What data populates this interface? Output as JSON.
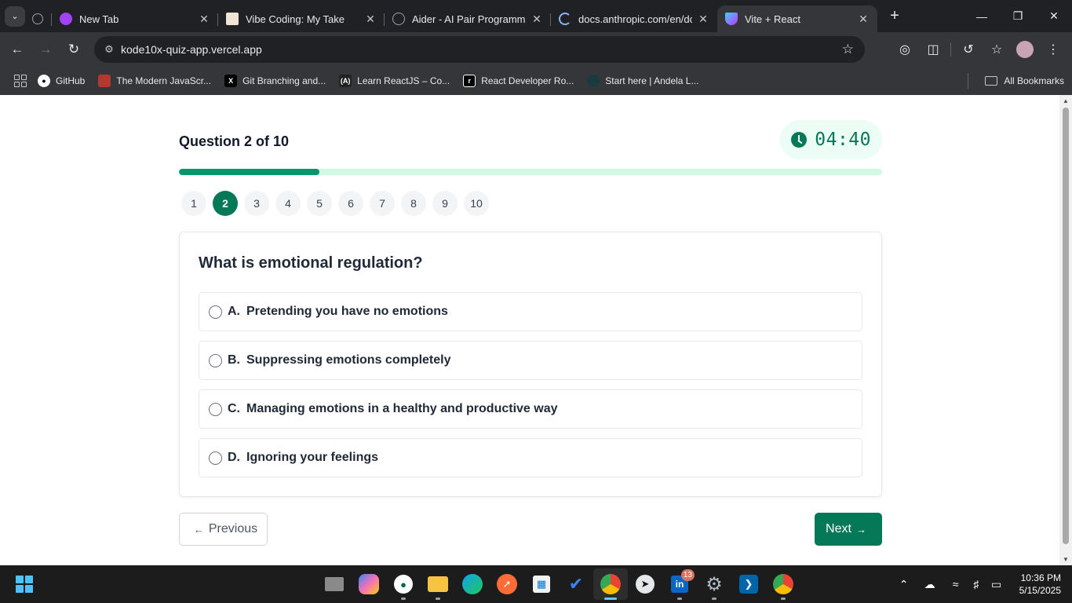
{
  "browser": {
    "tabs": [
      {
        "title": "New Tab",
        "icon": "new-tab-icon",
        "color": "#a142f4"
      },
      {
        "title": "Vibe Coding: My Take",
        "icon": "article-icon",
        "color": "#f1e4d3"
      },
      {
        "title": "Aider - AI Pair Programmin",
        "icon": "globe-icon",
        "color": "#9aa0a6"
      },
      {
        "title": "docs.anthropic.com/en/do",
        "icon": "loading-icon",
        "color": "#8ab4f8"
      },
      {
        "title": "Vite + React",
        "icon": "vite-icon",
        "color": "#bd34fe"
      }
    ],
    "url": "kode10x-quiz-app.vercel.app",
    "bookmarks": [
      {
        "label": "GitHub",
        "icon": "github-icon",
        "color": "#ffffff"
      },
      {
        "label": "The Modern JavaScr...",
        "icon": "javascript-info-icon",
        "color": "#b5382e"
      },
      {
        "label": "Git Branching and...",
        "icon": "git-icon",
        "color": "#000000"
      },
      {
        "label": "Learn ReactJS – Co...",
        "icon": "react-course-icon",
        "color": "#222222"
      },
      {
        "label": "React Developer Ro...",
        "icon": "roadmap-icon",
        "color": "#000000"
      },
      {
        "label": "Start here | Andela L...",
        "icon": "andela-icon",
        "color": "#173b3f"
      }
    ],
    "all_bookmarks": "All Bookmarks"
  },
  "quiz": {
    "counter": "Question 2 of 10",
    "timer": "04:40",
    "progress_fraction": 0.2,
    "numbers": [
      "1",
      "2",
      "3",
      "4",
      "5",
      "6",
      "7",
      "8",
      "9",
      "10"
    ],
    "current_index": 1,
    "question": "What is emotional regulation?",
    "options": [
      {
        "letter": "A.",
        "text": "Pretending you have no emotions"
      },
      {
        "letter": "B.",
        "text": "Suppressing emotions completely"
      },
      {
        "letter": "C.",
        "text": "Managing emotions in a healthy and productive way"
      },
      {
        "letter": "D.",
        "text": "Ignoring your feelings"
      }
    ],
    "prev_label": "Previous",
    "next_label": "Next",
    "accent_color": "#047857"
  },
  "taskbar": {
    "apps": [
      {
        "icon": "windows-start-icon"
      },
      {
        "icon": "file-explorer-icon"
      },
      {
        "icon": "copilot-icon"
      },
      {
        "icon": "mongodb-icon"
      },
      {
        "icon": "folder-icon"
      },
      {
        "icon": "edge-icon"
      },
      {
        "icon": "postman-icon"
      },
      {
        "icon": "microsoft-store-icon"
      },
      {
        "icon": "todo-icon"
      },
      {
        "icon": "chrome-icon"
      },
      {
        "icon": "clock-app-icon"
      },
      {
        "icon": "linkedin-icon",
        "badge": "13"
      },
      {
        "icon": "settings-icon"
      },
      {
        "icon": "vscode-icon"
      },
      {
        "icon": "chrome-profile-icon"
      }
    ],
    "time": "10:36 PM",
    "date": "5/15/2025"
  }
}
